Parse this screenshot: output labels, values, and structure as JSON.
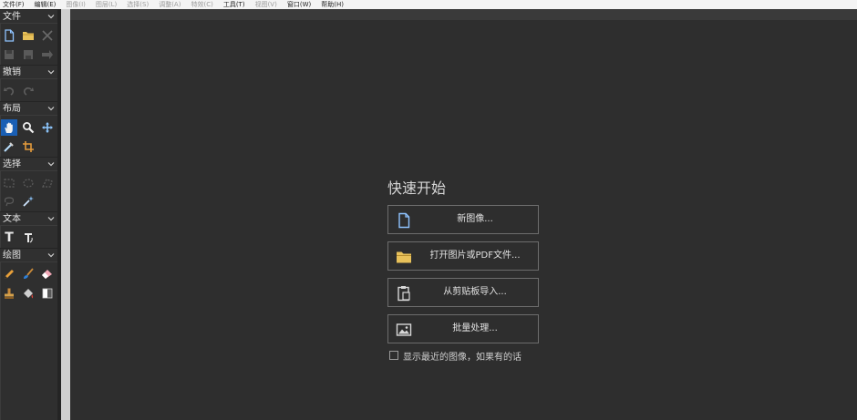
{
  "menu": [
    {
      "label": "文件(F)",
      "enabled": true
    },
    {
      "label": "编辑(E)",
      "enabled": true
    },
    {
      "label": "图像(I)",
      "enabled": false
    },
    {
      "label": "图层(L)",
      "enabled": false
    },
    {
      "label": "选择(S)",
      "enabled": false
    },
    {
      "label": "调整(A)",
      "enabled": false
    },
    {
      "label": "特效(C)",
      "enabled": false
    },
    {
      "label": "工具(T)",
      "enabled": true
    },
    {
      "label": "视图(V)",
      "enabled": false
    },
    {
      "label": "窗口(W)",
      "enabled": true
    },
    {
      "label": "帮助(H)",
      "enabled": true
    }
  ],
  "toolpanel": {
    "groups": {
      "file": {
        "title": "文件"
      },
      "undo": {
        "title": "撤销"
      },
      "layout": {
        "title": "布局"
      },
      "select": {
        "title": "选择"
      },
      "text": {
        "title": "文本"
      },
      "draw": {
        "title": "绘图"
      }
    },
    "text_tool_glyph": "T"
  },
  "quick_start": {
    "title": "快速开始",
    "buttons": {
      "new_image": "新图像...",
      "open_file": "打开图片或PDF文件...",
      "import_clipboard": "从剪贴板导入...",
      "batch": "批量处理..."
    },
    "show_recent": {
      "label": "显示最近的图像，如果有的话",
      "checked": false
    }
  },
  "colors": {
    "panel_bg": "#2f2f2f",
    "workarea_bg": "#2e2e2e",
    "active_tool": "#1a5fb4",
    "folder_icon": "#e8c15a",
    "button_border": "#6d6d6d"
  }
}
